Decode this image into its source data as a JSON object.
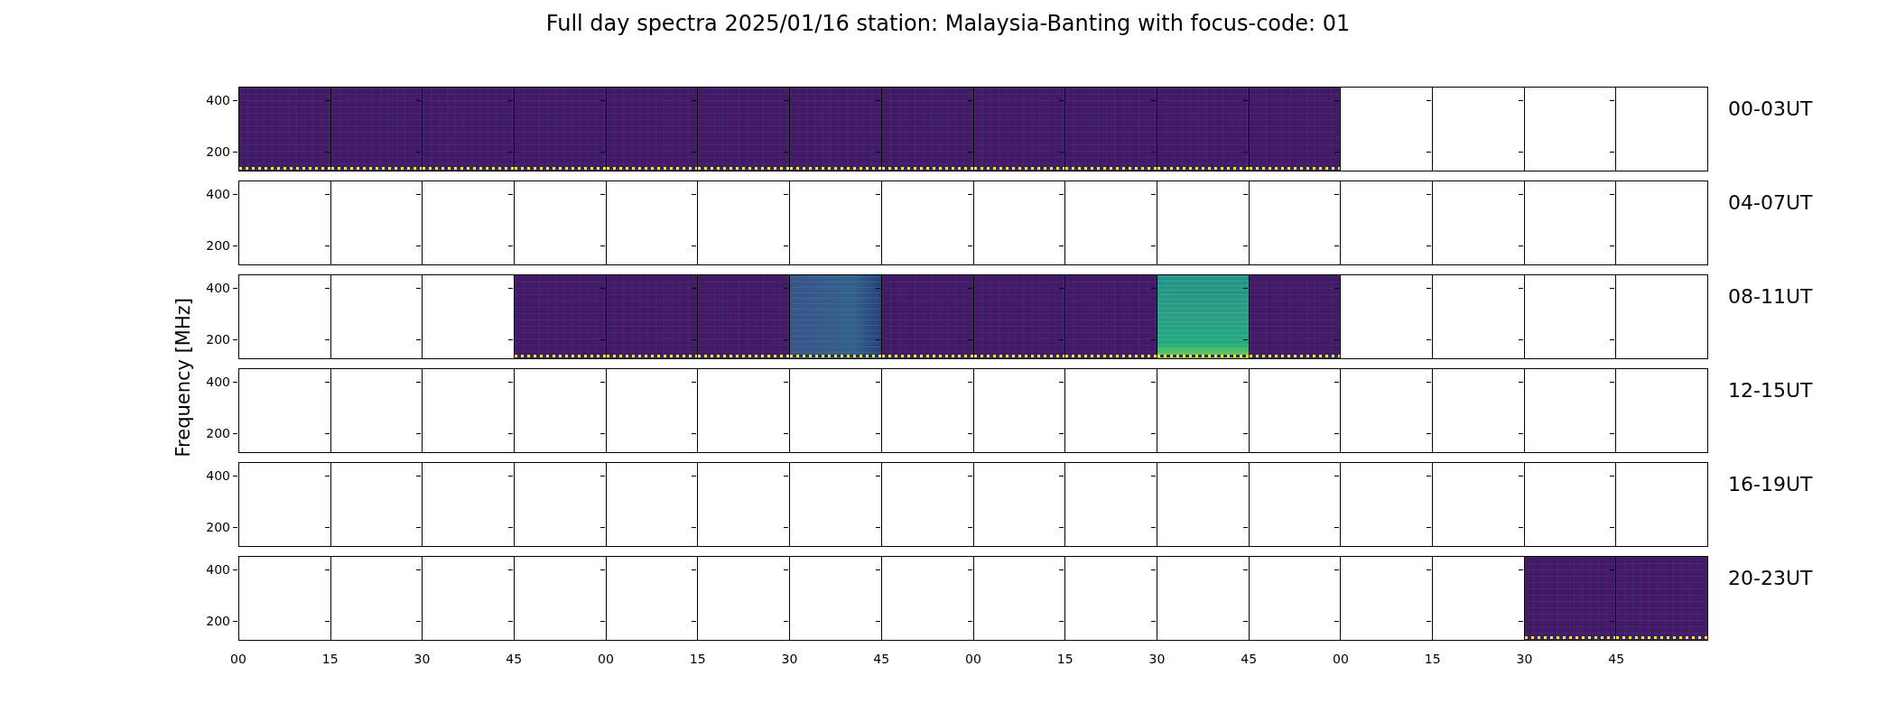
{
  "title": "Full day spectra 2025/01/16 station: Malaysia-Banting with focus-code: 01",
  "ylabel": "Frequency [MHz]",
  "rows": [
    {
      "label": "00-03UT",
      "yticks": [
        "400",
        "200"
      ],
      "panels": [
        {
          "kind": "dark"
        },
        {
          "kind": "dark"
        },
        {
          "kind": "dark"
        },
        {
          "kind": "dark"
        },
        {
          "kind": "dark"
        },
        {
          "kind": "dark"
        },
        {
          "kind": "dark"
        },
        {
          "kind": "dark"
        },
        {
          "kind": "dark"
        },
        {
          "kind": "dark"
        },
        {
          "kind": "dark"
        },
        {
          "kind": "dark"
        },
        {
          "kind": "empty"
        },
        {
          "kind": "empty"
        },
        {
          "kind": "empty"
        },
        {
          "kind": "empty"
        }
      ]
    },
    {
      "label": "04-07UT",
      "yticks": [
        "400",
        "200"
      ],
      "panels": [
        {
          "kind": "empty"
        },
        {
          "kind": "empty"
        },
        {
          "kind": "empty"
        },
        {
          "kind": "empty"
        },
        {
          "kind": "empty"
        },
        {
          "kind": "empty"
        },
        {
          "kind": "empty"
        },
        {
          "kind": "empty"
        },
        {
          "kind": "empty"
        },
        {
          "kind": "empty"
        },
        {
          "kind": "empty"
        },
        {
          "kind": "empty"
        },
        {
          "kind": "empty"
        },
        {
          "kind": "empty"
        },
        {
          "kind": "empty"
        },
        {
          "kind": "empty"
        }
      ]
    },
    {
      "label": "08-11UT",
      "yticks": [
        "400",
        "200"
      ],
      "panels": [
        {
          "kind": "empty"
        },
        {
          "kind": "empty"
        },
        {
          "kind": "empty"
        },
        {
          "kind": "dark"
        },
        {
          "kind": "dark"
        },
        {
          "kind": "dark"
        },
        {
          "kind": "blue"
        },
        {
          "kind": "dark"
        },
        {
          "kind": "dark"
        },
        {
          "kind": "dark"
        },
        {
          "kind": "green"
        },
        {
          "kind": "dark"
        },
        {
          "kind": "empty"
        },
        {
          "kind": "empty"
        },
        {
          "kind": "empty"
        },
        {
          "kind": "empty"
        }
      ]
    },
    {
      "label": "12-15UT",
      "yticks": [
        "400",
        "200"
      ],
      "panels": [
        {
          "kind": "empty"
        },
        {
          "kind": "empty"
        },
        {
          "kind": "empty"
        },
        {
          "kind": "empty"
        },
        {
          "kind": "empty"
        },
        {
          "kind": "empty"
        },
        {
          "kind": "empty"
        },
        {
          "kind": "empty"
        },
        {
          "kind": "empty"
        },
        {
          "kind": "empty"
        },
        {
          "kind": "empty"
        },
        {
          "kind": "empty"
        },
        {
          "kind": "empty"
        },
        {
          "kind": "empty"
        },
        {
          "kind": "empty"
        },
        {
          "kind": "empty"
        }
      ]
    },
    {
      "label": "16-19UT",
      "yticks": [
        "400",
        "200"
      ],
      "panels": [
        {
          "kind": "empty"
        },
        {
          "kind": "empty"
        },
        {
          "kind": "empty"
        },
        {
          "kind": "empty"
        },
        {
          "kind": "empty"
        },
        {
          "kind": "empty"
        },
        {
          "kind": "empty"
        },
        {
          "kind": "empty"
        },
        {
          "kind": "empty"
        },
        {
          "kind": "empty"
        },
        {
          "kind": "empty"
        },
        {
          "kind": "empty"
        },
        {
          "kind": "empty"
        },
        {
          "kind": "empty"
        },
        {
          "kind": "empty"
        },
        {
          "kind": "empty"
        }
      ]
    },
    {
      "label": "20-23UT",
      "yticks": [
        "400",
        "200"
      ],
      "panels": [
        {
          "kind": "empty"
        },
        {
          "kind": "empty"
        },
        {
          "kind": "empty"
        },
        {
          "kind": "empty"
        },
        {
          "kind": "empty"
        },
        {
          "kind": "empty"
        },
        {
          "kind": "empty"
        },
        {
          "kind": "empty"
        },
        {
          "kind": "empty"
        },
        {
          "kind": "empty"
        },
        {
          "kind": "empty"
        },
        {
          "kind": "empty"
        },
        {
          "kind": "empty"
        },
        {
          "kind": "empty"
        },
        {
          "kind": "dark"
        },
        {
          "kind": "dark"
        }
      ]
    }
  ],
  "xticks": [
    "00",
    "15",
    "30",
    "45",
    "00",
    "15",
    "30",
    "45",
    "00",
    "15",
    "30",
    "45",
    "00",
    "15",
    "30",
    "45"
  ]
}
